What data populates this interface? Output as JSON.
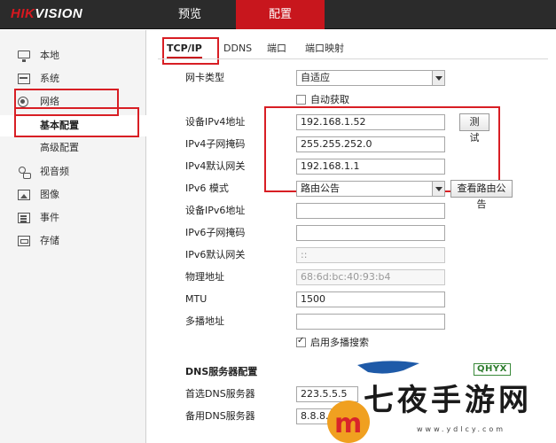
{
  "header": {
    "logo_red": "HIK",
    "logo_white": "VISION",
    "nav": [
      {
        "label": "预览"
      },
      {
        "label": "配置"
      }
    ]
  },
  "sidebar": {
    "items": [
      {
        "label": "本地",
        "icon": "monitor-icon"
      },
      {
        "label": "系统",
        "icon": "system-icon"
      },
      {
        "label": "网络",
        "icon": "network-icon"
      },
      {
        "label": "基本配置"
      },
      {
        "label": "高级配置"
      },
      {
        "label": "视音频",
        "icon": "audio-video-icon"
      },
      {
        "label": "图像",
        "icon": "image-icon"
      },
      {
        "label": "事件",
        "icon": "event-icon"
      },
      {
        "label": "存储",
        "icon": "storage-icon"
      }
    ]
  },
  "tabs": [
    {
      "label": "TCP/IP"
    },
    {
      "label": "DDNS"
    },
    {
      "label": "端口"
    },
    {
      "label": "端口映射"
    }
  ],
  "form": {
    "nic_type": {
      "label": "网卡类型",
      "value": "自适应"
    },
    "dhcp": {
      "label": "自动获取",
      "checked": false
    },
    "ipv4_address": {
      "label": "设备IPv4地址",
      "value": "192.168.1.52"
    },
    "test_button": "测试",
    "ipv4_mask": {
      "label": "IPv4子网掩码",
      "value": "255.255.252.0"
    },
    "ipv4_gateway": {
      "label": "IPv4默认网关",
      "value": "192.168.1.1"
    },
    "ipv6_mode": {
      "label": "IPv6 模式",
      "value": "路由公告"
    },
    "view_route_button": "查看路由公告",
    "ipv6_address": {
      "label": "设备IPv6地址",
      "value": ""
    },
    "ipv6_prefix": {
      "label": "IPv6子网掩码",
      "value": ""
    },
    "ipv6_gateway": {
      "label": "IPv6默认网关",
      "value": "::"
    },
    "mac": {
      "label": "物理地址",
      "value": "68:6d:bc:40:93:b4"
    },
    "mtu": {
      "label": "MTU",
      "value": "1500"
    },
    "multicast": {
      "label": "多播地址",
      "value": ""
    },
    "multicast_search": {
      "label": "启用多播搜索",
      "checked": true
    }
  },
  "dns": {
    "title": "DNS服务器配置",
    "preferred": {
      "label": "首选DNS服务器",
      "value": "223.5.5.5"
    },
    "alternate": {
      "label": "备用DNS服务器",
      "value": "8.8.8.8"
    }
  },
  "watermark": {
    "badge": "QHYX",
    "text": "七夜手游网",
    "url": "www.ydlcy.com"
  },
  "colors": {
    "topbar": "#2b2b2b",
    "accent": "#c8161d",
    "highlight": "#d81e24"
  }
}
